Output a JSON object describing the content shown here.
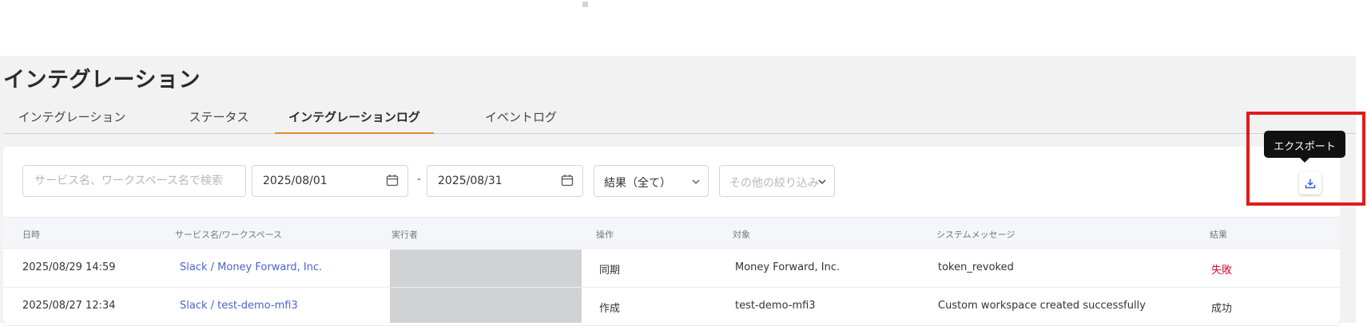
{
  "page_title": "インテグレーション",
  "tabs": [
    {
      "label": "インテグレーション"
    },
    {
      "label": "ステータス"
    },
    {
      "label": "インテグレーションログ"
    },
    {
      "label": "イベントログ"
    }
  ],
  "active_tab": "インテグレーションログ",
  "filters": {
    "search_placeholder": "サービス名、ワークスペース名で検索",
    "date_from": "2025/08/01",
    "date_separator": "-",
    "date_to": "2025/08/31",
    "result_select": "結果（全て）",
    "other_filters": "その他の絞り込み"
  },
  "export_tooltip": "エクスポート",
  "table": {
    "headers": [
      "日時",
      "サービス名/ワークスペース",
      "実行者",
      "操作",
      "対象",
      "システムメッセージ",
      "結果"
    ],
    "rows": [
      {
        "datetime": "2025/08/29 14:59",
        "service": "Slack / Money Forward, Inc.",
        "executor": "",
        "operation": "同期",
        "target": "Money Forward, Inc.",
        "message": "token_revoked",
        "result": "失敗"
      },
      {
        "datetime": "2025/08/27 12:34",
        "service": "Slack / test-demo-mfi3",
        "executor": "",
        "operation": "作成",
        "target": "test-demo-mfi3",
        "message": "Custom workspace created successfully",
        "result": "成功"
      }
    ]
  },
  "colors": {
    "accent_tab": "#e0892e",
    "link": "#4a63cf",
    "fail": "#d0103a",
    "highlight": "#e01b1b"
  }
}
